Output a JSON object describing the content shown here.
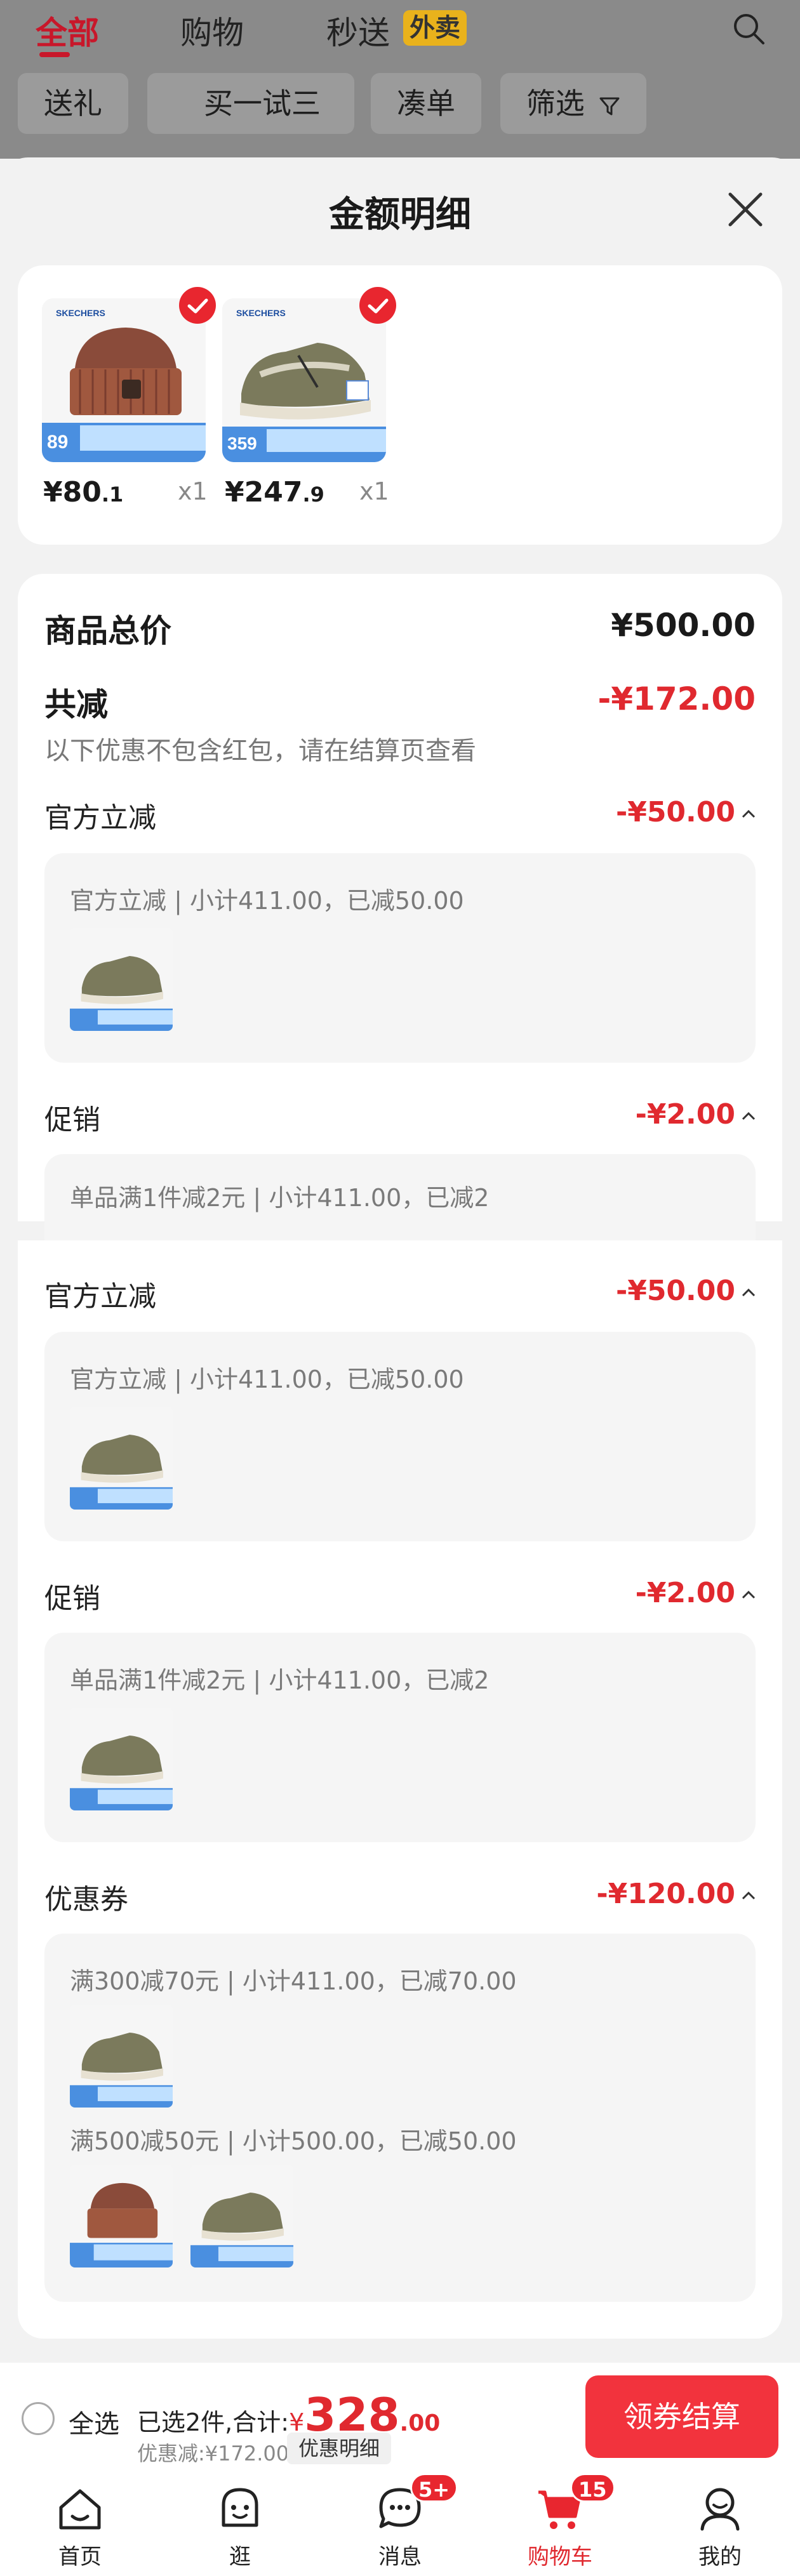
{
  "header": {
    "tabs": [
      {
        "label": "全部"
      },
      {
        "label": "购物"
      },
      {
        "label": "秒送"
      }
    ],
    "waimai_tag": "外卖",
    "chips": [
      "送礼",
      "买一试三",
      "凑单",
      "筛选"
    ]
  },
  "sheet": {
    "title": "金额明细",
    "products": [
      {
        "price_main": "¥80",
        "price_dec": ".1",
        "qty": "x1",
        "banner_price": "89",
        "name": "hat"
      },
      {
        "price_main": "¥247",
        "price_dec": ".9",
        "qty": "x1",
        "banner_price": "359",
        "name": "shoe"
      }
    ],
    "total": {
      "label": "商品总价",
      "value": "¥500.00"
    },
    "discount": {
      "label": "共减",
      "value": "-¥172.00",
      "note": "以下优惠不包含红包，请在结算页查看"
    },
    "sections": [
      {
        "label": "官方立减",
        "value": "-¥50.00",
        "detail": "官方立减 | 小计411.00，已减50.00"
      },
      {
        "label": "促销",
        "value": "-¥2.00",
        "detail": "单品满1件减2元 | 小计411.00，已减2"
      },
      {
        "label": "官方立减",
        "value": "-¥50.00",
        "detail": "官方立减 | 小计411.00，已减50.00"
      },
      {
        "label": "促销",
        "value": "-¥2.00",
        "detail": "单品满1件减2元 | 小计411.00，已减2"
      },
      {
        "label": "优惠券",
        "value": "-¥120.00",
        "detail": "满300减70元 | 小计411.00，已减70.00",
        "detail2": "满500减50元 | 小计500.00，已减50.00"
      }
    ]
  },
  "checkout": {
    "select_all": "全选",
    "selected": "已选2件,合计:",
    "currency": "¥",
    "amount": "328",
    "amount_dec": ".00",
    "saved": "优惠减:¥172.00",
    "detail_btn": "优惠明细",
    "pay_btn": "领券结算"
  },
  "nav": {
    "items": [
      {
        "label": "首页"
      },
      {
        "label": "逛"
      },
      {
        "label": "消息",
        "badge": "5+"
      },
      {
        "label": "购物车",
        "badge": "15"
      },
      {
        "label": "我的"
      }
    ]
  },
  "colors": {
    "accent": "#e0292f",
    "brand": "#c8172a"
  }
}
